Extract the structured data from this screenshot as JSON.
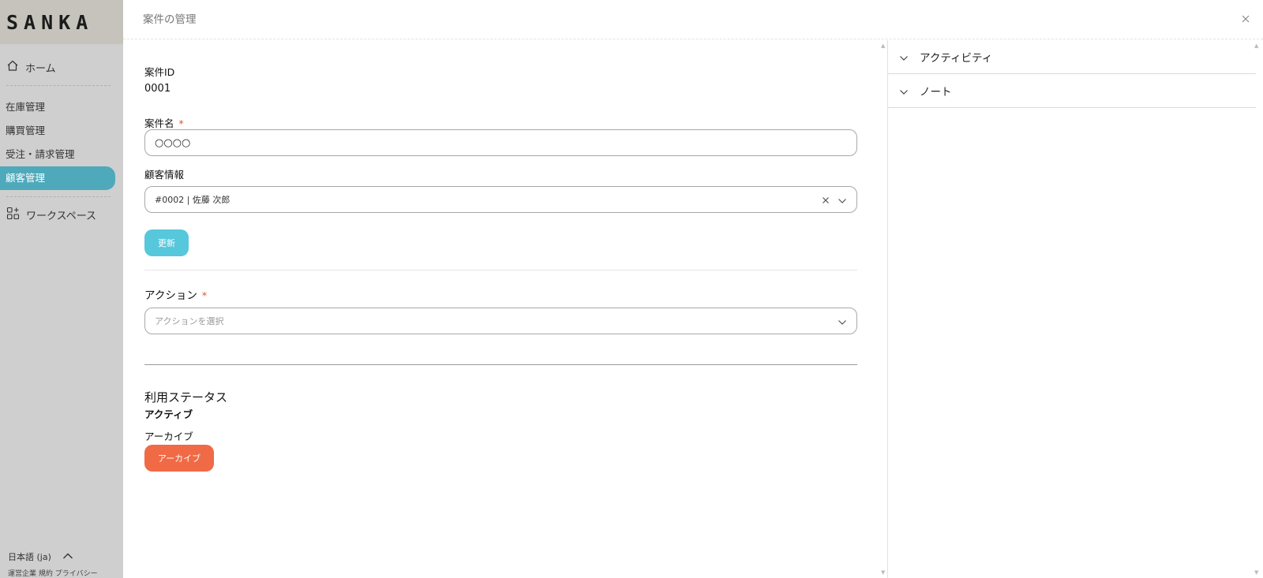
{
  "app": {
    "logo": "SANKA"
  },
  "sidebar": {
    "home_label": "ホーム",
    "items": [
      {
        "label": "在庫管理",
        "active": false
      },
      {
        "label": "購買管理",
        "active": false
      },
      {
        "label": "受注・請求管理",
        "active": false
      },
      {
        "label": "顧客管理",
        "active": true
      }
    ],
    "workspace_label": "ワークスペース",
    "language": "日本語 (ja)",
    "footer_links": [
      "運営企業",
      "規約",
      "プライバシー"
    ]
  },
  "header": {
    "title": "案件の管理"
  },
  "form": {
    "deal_id_label": "案件ID",
    "deal_id_value": "0001",
    "deal_name_label": "案件名",
    "deal_name_value": "○○○○",
    "required_mark": "*",
    "customer_label": "顧客情報",
    "customer_value": "#0002 | 佐藤 次郎",
    "update_button": "更新",
    "action_label": "アクション",
    "action_placeholder": "アクションを選択",
    "usage_status_title": "利用ステータス",
    "usage_status_value": "アクティブ",
    "archive_label": "アーカイブ",
    "archive_button": "アーカイブ"
  },
  "right_panel": {
    "sections": [
      {
        "label": "アクティビティ"
      },
      {
        "label": "ノート"
      }
    ]
  },
  "colors": {
    "accent": "#57c7dc",
    "active_nav": "#4ea9bb",
    "danger": "#f06a45",
    "required": "#e0503a"
  }
}
